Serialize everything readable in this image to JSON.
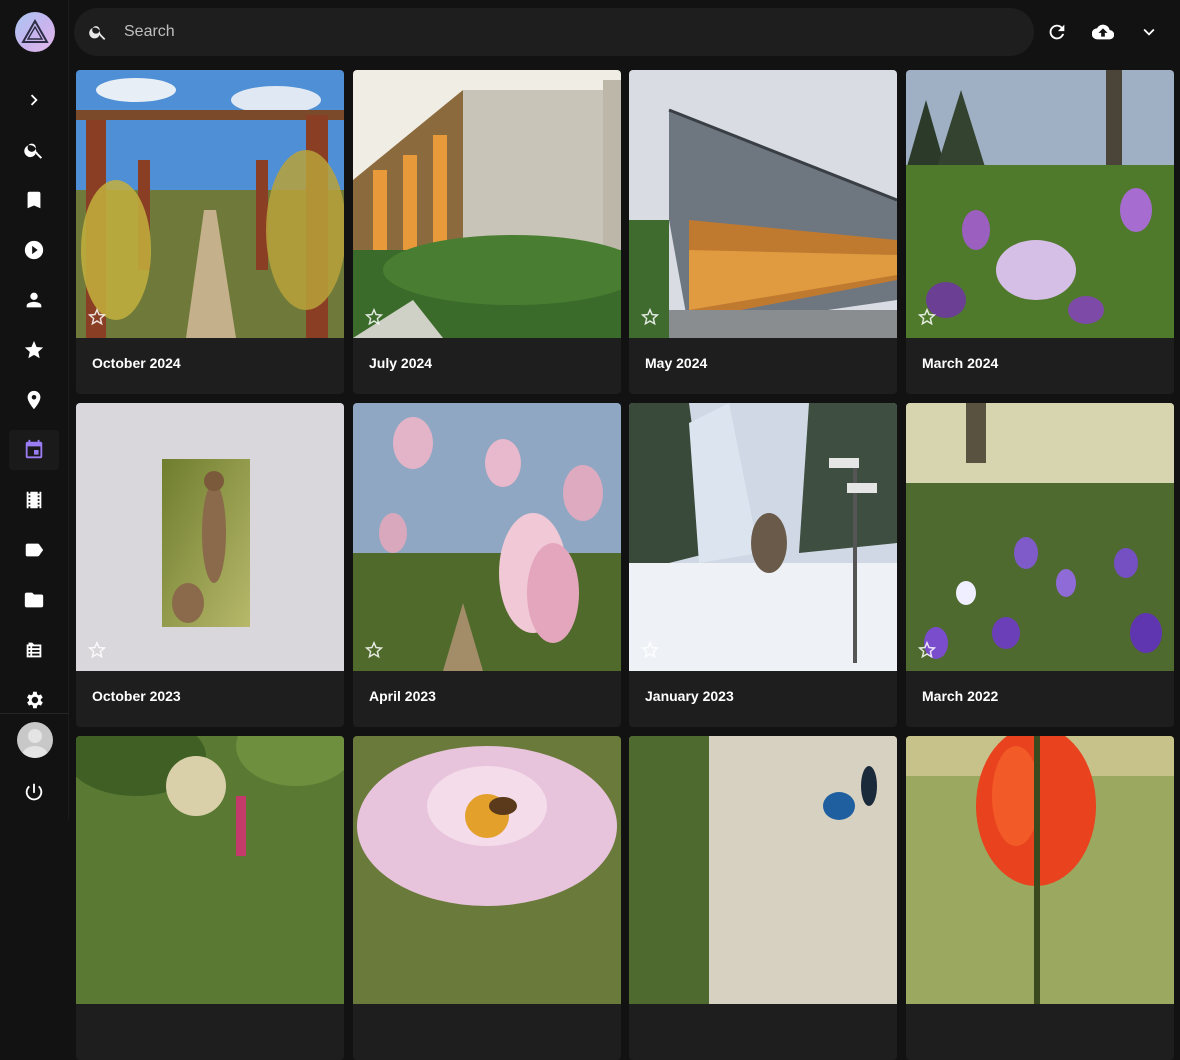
{
  "search": {
    "placeholder": "Search"
  },
  "nav": [
    {
      "icon": "chevron-right-icon"
    },
    {
      "icon": "search-icon"
    },
    {
      "icon": "bookmark-icon"
    },
    {
      "icon": "play-circle-icon"
    },
    {
      "icon": "person-icon"
    },
    {
      "icon": "star-icon"
    },
    {
      "icon": "map-pin-icon"
    },
    {
      "icon": "calendar-icon",
      "active": true
    },
    {
      "icon": "film-icon"
    },
    {
      "icon": "label-tag-icon"
    },
    {
      "icon": "folder-icon"
    },
    {
      "icon": "library-icon"
    },
    {
      "icon": "gear-icon"
    }
  ],
  "accent_color": "#9a7df3",
  "albums": [
    {
      "title": "October 2024",
      "favorite": false
    },
    {
      "title": "July 2024",
      "favorite": false
    },
    {
      "title": "May 2024",
      "favorite": false
    },
    {
      "title": "March 2024",
      "favorite": false
    },
    {
      "title": "October 2023",
      "favorite": false
    },
    {
      "title": "April 2023",
      "favorite": false
    },
    {
      "title": "January 2023",
      "favorite": false
    },
    {
      "title": "March 2022",
      "favorite": false
    },
    {
      "title": "",
      "favorite": false
    },
    {
      "title": "",
      "favorite": false
    },
    {
      "title": "",
      "favorite": false
    },
    {
      "title": "",
      "favorite": false
    }
  ]
}
